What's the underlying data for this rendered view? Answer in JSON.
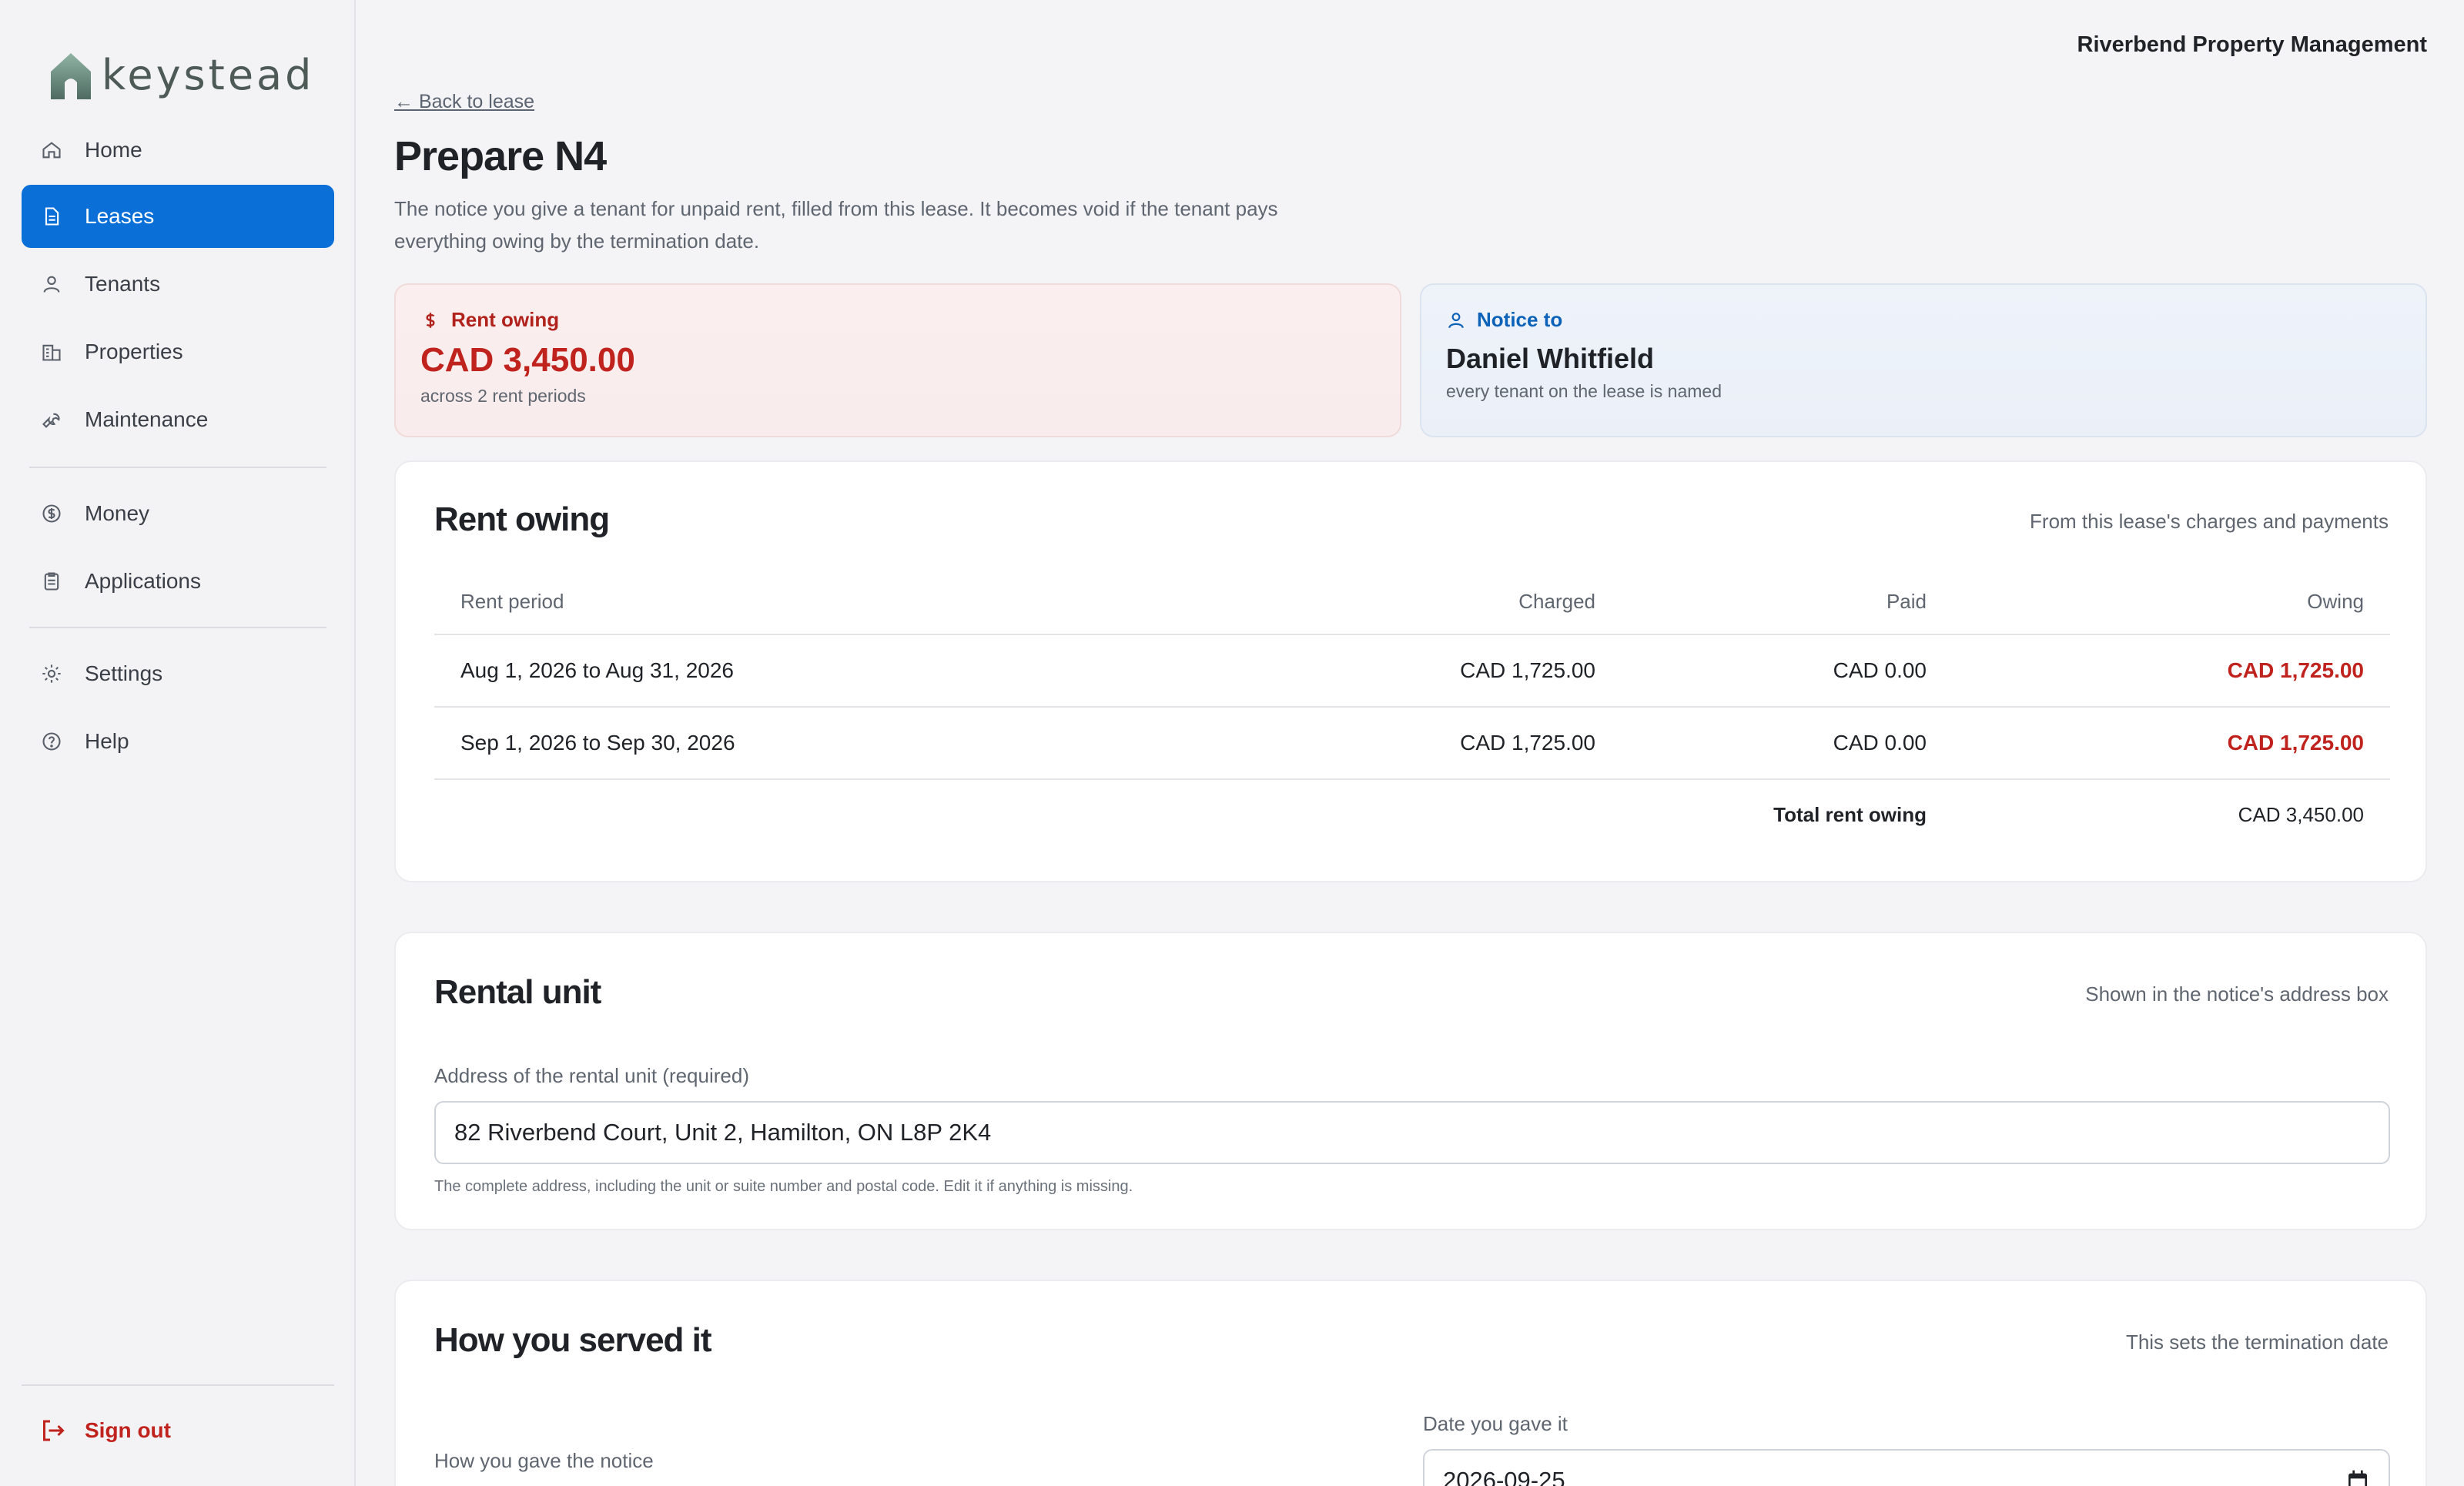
{
  "brand": {
    "name": "keystead"
  },
  "org": {
    "name": "Riverbend Property Management"
  },
  "sidebar": {
    "items": [
      {
        "label": "Home",
        "icon": "home-icon"
      },
      {
        "label": "Leases",
        "icon": "document-icon",
        "active": true
      },
      {
        "label": "Tenants",
        "icon": "person-icon"
      },
      {
        "label": "Properties",
        "icon": "building-icon"
      },
      {
        "label": "Maintenance",
        "icon": "wrench-icon"
      },
      {
        "label": "Money",
        "icon": "dollar-circle-icon"
      },
      {
        "label": "Applications",
        "icon": "clipboard-icon"
      },
      {
        "label": "Settings",
        "icon": "gear-icon"
      },
      {
        "label": "Help",
        "icon": "question-circle-icon"
      }
    ],
    "signout": "Sign out"
  },
  "page": {
    "back": "← Back to lease",
    "title": "Prepare N4",
    "description": "The notice you give a tenant for unpaid rent, filled from this lease. It becomes void if the tenant pays everything owing by the termination date."
  },
  "summary": {
    "owing": {
      "label": "Rent owing",
      "value": "CAD 3,450.00",
      "sub": "across 2 rent periods"
    },
    "notice": {
      "label": "Notice to",
      "value": "Daniel Whitfield",
      "sub": "every tenant on the lease is named"
    }
  },
  "rent_table": {
    "title": "Rent owing",
    "note": "From this lease's charges and payments",
    "headers": [
      "Rent period",
      "Charged",
      "Paid",
      "Owing"
    ],
    "rows": [
      [
        "Aug 1, 2026 to Aug 31, 2026",
        "CAD 1,725.00",
        "CAD 0.00",
        "CAD 1,725.00"
      ],
      [
        "Sep 1, 2026 to Sep 30, 2026",
        "CAD 1,725.00",
        "CAD 0.00",
        "CAD 1,725.00"
      ]
    ],
    "total_label": "Total rent owing",
    "total_value": "CAD 3,450.00"
  },
  "rental_unit": {
    "title": "Rental unit",
    "note": "Shown in the notice's address box",
    "field_label": "Address of the rental unit (required)",
    "value": "82 Riverbend Court, Unit 2, Hamilton, ON  L8P 2K4",
    "help": "The complete address, including the unit or suite number and postal code. Edit it if anything is missing."
  },
  "served": {
    "title": "How you served it",
    "note": "This sets the termination date",
    "method_label": "How you gave the notice",
    "date_label": "Date you gave it",
    "date_value": "2026-09-25"
  },
  "colors": {
    "accent": "#0b6fd8",
    "danger": "#c0231d"
  }
}
